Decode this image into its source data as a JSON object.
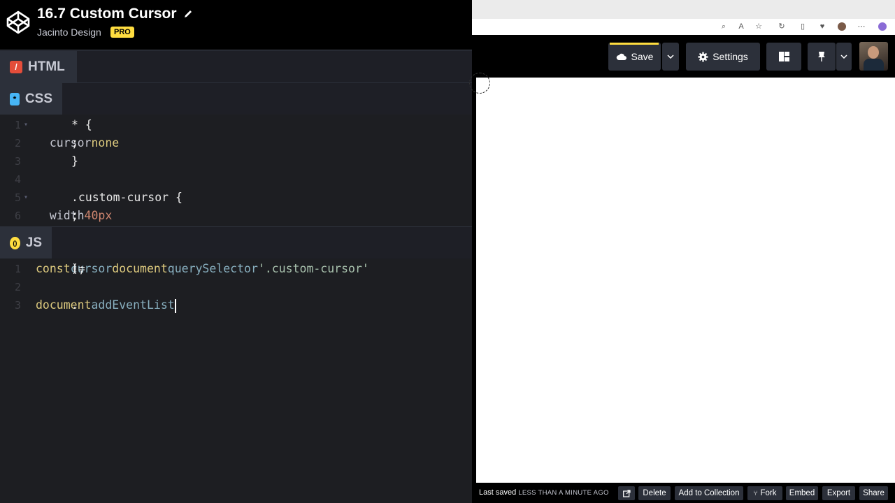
{
  "header": {
    "title": "16.7 Custom Cursor",
    "author": "Jacinto Design",
    "badge": "PRO"
  },
  "panels": {
    "html": {
      "label": "HTML",
      "badge_icon": "/"
    },
    "css": {
      "label": "CSS",
      "badge_icon": "*",
      "lines": [
        {
          "n": "1",
          "segments": [
            [
              "txt",
              "* {"
            ]
          ]
        },
        {
          "n": "2",
          "segments": [
            [
              "prop",
              "  cursor"
            ],
            [
              "txt",
              ": "
            ],
            [
              "kw",
              "none"
            ],
            [
              "txt",
              ";"
            ]
          ]
        },
        {
          "n": "3",
          "segments": [
            [
              "txt",
              "}"
            ]
          ]
        },
        {
          "n": "4",
          "segments": []
        },
        {
          "n": "5",
          "segments": [
            [
              "txt",
              ".custom-cursor {"
            ]
          ]
        },
        {
          "n": "6",
          "segments": [
            [
              "prop",
              "  width"
            ],
            [
              "txt",
              ": "
            ],
            [
              "num",
              "40px"
            ],
            [
              "txt",
              ";"
            ]
          ]
        }
      ]
    },
    "js": {
      "label": "JS",
      "badge_icon": "()",
      "lines": [
        {
          "n": "1",
          "segments": [
            [
              "kw",
              "const"
            ],
            [
              "txt",
              " "
            ],
            [
              "var",
              "cursor"
            ],
            [
              "txt",
              " = "
            ],
            [
              "kw",
              "document"
            ],
            [
              "txt",
              "."
            ],
            [
              "var",
              "querySelector"
            ],
            [
              "txt",
              "("
            ],
            [
              "str",
              "'.custom-cursor'"
            ],
            [
              "txt",
              ");"
            ]
          ]
        },
        {
          "n": "2",
          "segments": []
        },
        {
          "n": "3",
          "segments": [
            [
              "kw",
              "document"
            ],
            [
              "txt",
              "."
            ],
            [
              "var",
              "addEventList"
            ]
          ]
        }
      ]
    }
  },
  "toolbar": {
    "save_label": "Save",
    "settings_label": "Settings"
  },
  "footer": {
    "last_saved_label": "Last saved",
    "last_saved_when": "LESS THAN A MINUTE AGO",
    "delete_label": "Delete",
    "add_to_collection_label": "Add to Collection",
    "fork_label": "Fork",
    "embed_label": "Embed",
    "export_label": "Export",
    "share_label": "Share"
  },
  "colors": {
    "accent_yellow": "#ffdd40",
    "html_badge": "#e44d3a",
    "css_badge": "#47b5f5",
    "js_badge": "#ffdd40"
  }
}
